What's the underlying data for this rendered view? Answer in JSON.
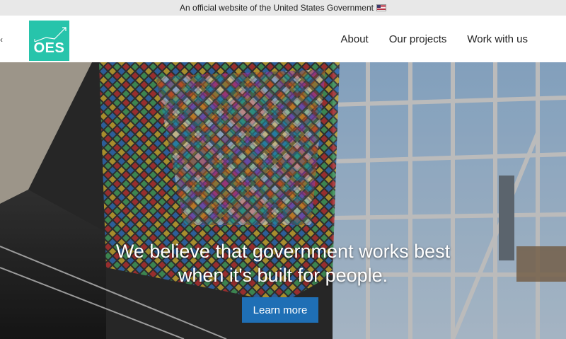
{
  "banner": {
    "text": "An official website of the United States Government",
    "flag_icon": "us-flag-icon"
  },
  "header": {
    "logo_text": "OES",
    "logo_color": "#27c4ab",
    "nav": [
      {
        "label": "About"
      },
      {
        "label": "Our projects"
      },
      {
        "label": "Work with us"
      }
    ]
  },
  "hero": {
    "headline_line1": "We believe that government works best",
    "headline_line2": "when it's built for people.",
    "button_label": "Learn more",
    "button_color": "#1f6fb5"
  }
}
